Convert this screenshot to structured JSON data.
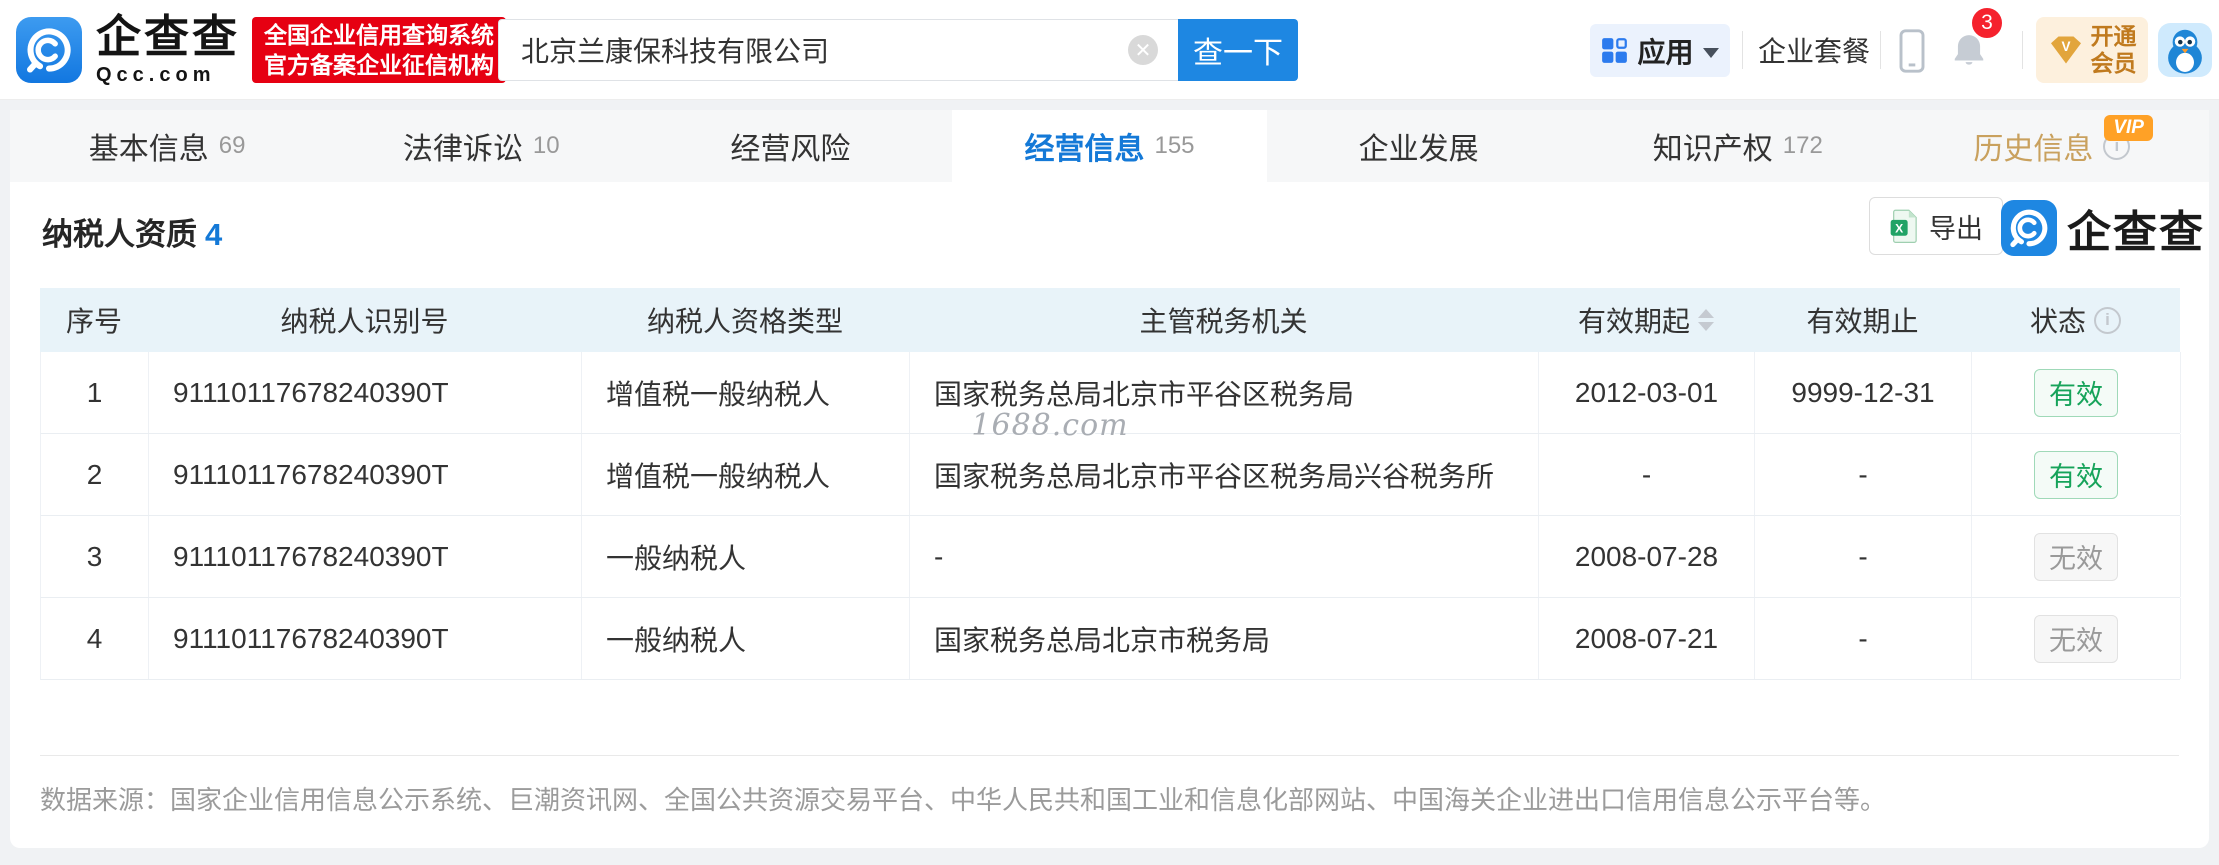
{
  "colors": {
    "brand_blue": "#1e87e2",
    "active_tab_blue": "#1479d7",
    "cert_badge_red": "#e60012",
    "valid_green": "#16a35a",
    "invalid_gray": "#9a9a9a",
    "history_tab_gold": "#c9a15e",
    "vip_orange": "#ffa126",
    "table_header_bg": "#e8f3f9"
  },
  "header": {
    "logo": {
      "brand": "企查查",
      "domain": "Qcc.com",
      "badge_line1": "全国企业信用查询系统",
      "badge_line2": "官方备案企业征信机构"
    },
    "search": {
      "value": "北京兰康保科技有限公司",
      "button_label": "查一下",
      "clear_symbol": "✕"
    },
    "nav": {
      "apps_label": "应用",
      "package_label": "企业套餐",
      "notification_count": "3",
      "vip_line1": "开通",
      "vip_line2": "会员"
    }
  },
  "tabs": [
    {
      "label": "基本信息",
      "count": "69",
      "active": false,
      "vip": false
    },
    {
      "label": "法律诉讼",
      "count": "10",
      "active": false,
      "vip": false
    },
    {
      "label": "经营风险",
      "count": "",
      "active": false,
      "vip": false
    },
    {
      "label": "经营信息",
      "count": "155",
      "active": true,
      "vip": false
    },
    {
      "label": "企业发展",
      "count": "",
      "active": false,
      "vip": false
    },
    {
      "label": "知识产权",
      "count": "172",
      "active": false,
      "vip": false
    },
    {
      "label": "历史信息",
      "count": "",
      "active": false,
      "vip": true,
      "vip_badge": "VIP",
      "info_symbol": "i"
    }
  ],
  "section": {
    "title": "纳税人资质",
    "count": "4",
    "export_label": "导出",
    "watermark_brand": "企查查"
  },
  "table": {
    "headers": [
      "序号",
      "纳税人识别号",
      "纳税人资格类型",
      "主管税务机关",
      "有效期起",
      "有效期止",
      "状态"
    ],
    "status_info_symbol": "i",
    "rows": [
      {
        "no": "1",
        "tax_id": "91110117678240390T",
        "type": "增值税一般纳税人",
        "authority": "国家税务总局北京市平谷区税务局",
        "start": "2012-03-01",
        "end": "9999-12-31",
        "status": "有效",
        "valid": true
      },
      {
        "no": "2",
        "tax_id": "91110117678240390T",
        "type": "增值税一般纳税人",
        "authority": "国家税务总局北京市平谷区税务局兴谷税务所",
        "start": "-",
        "end": "-",
        "status": "有效",
        "valid": true
      },
      {
        "no": "3",
        "tax_id": "91110117678240390T",
        "type": "一般纳税人",
        "authority": "-",
        "start": "2008-07-28",
        "end": "-",
        "status": "无效",
        "valid": false
      },
      {
        "no": "4",
        "tax_id": "91110117678240390T",
        "type": "一般纳税人",
        "authority": "国家税务总局北京市税务局",
        "start": "2008-07-21",
        "end": "-",
        "status": "无效",
        "valid": false
      }
    ]
  },
  "watermarks": {
    "center_text": "1688.com"
  },
  "footer": {
    "source_text": "数据来源：国家企业信用信息公示系统、巨潮资讯网、全国公共资源交易平台、中华人民共和国工业和信息化部网站、中国海关企业进出口信用信息公示平台等。"
  }
}
